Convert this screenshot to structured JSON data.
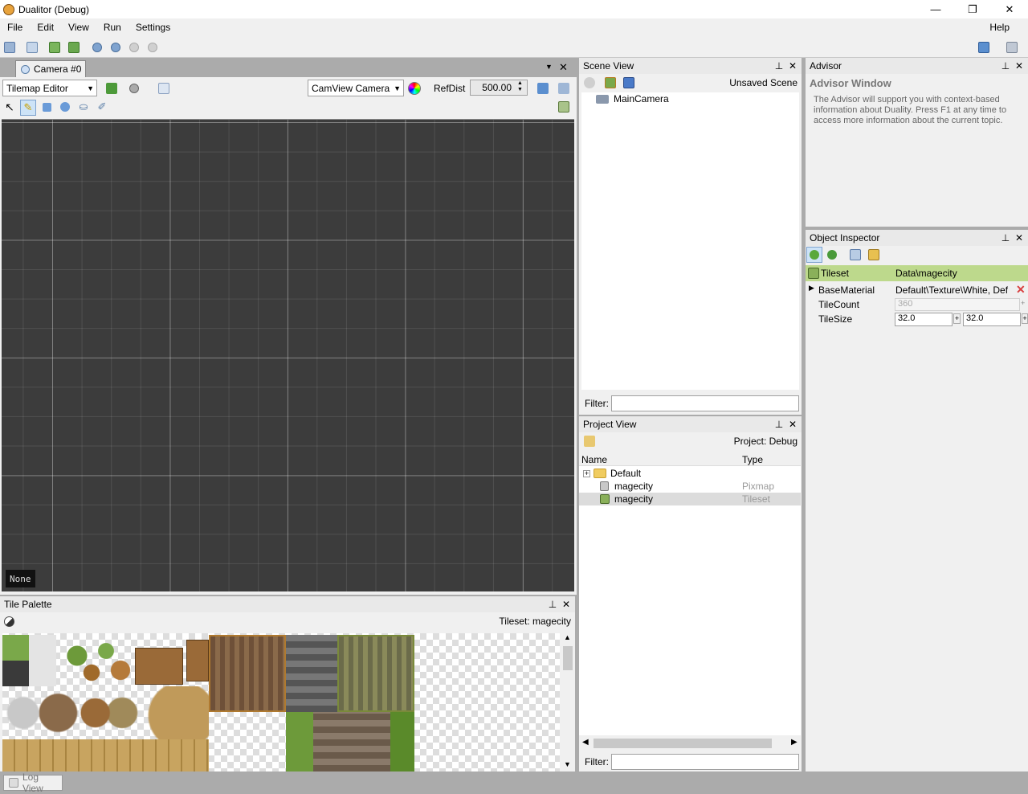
{
  "window": {
    "title": "Dualitor (Debug)",
    "minimize": "—",
    "restore": "❐",
    "close": "✕"
  },
  "menu": {
    "file": "File",
    "edit": "Edit",
    "view": "View",
    "run": "Run",
    "settings": "Settings",
    "help": "Help"
  },
  "camera": {
    "tab_label": "Camera #0",
    "editor_mode": "Tilemap Editor",
    "view_mode": "CamView Camera",
    "refdist_label": "RefDist",
    "refdist_value": "500.00",
    "status_label": "None"
  },
  "tile_palette": {
    "title": "Tile Palette",
    "tileset_label": "Tileset: magecity"
  },
  "scene_view": {
    "title": "Scene View",
    "status": "Unsaved Scene",
    "items": [
      "MainCamera"
    ],
    "filter_label": "Filter:"
  },
  "project_view": {
    "title": "Project View",
    "project": "Project: Debug",
    "columns": {
      "name": "Name",
      "type": "Type"
    },
    "rows": [
      {
        "name": "Default",
        "type": ""
      },
      {
        "name": "magecity",
        "type": "Pixmap"
      },
      {
        "name": "magecity",
        "type": "Tileset"
      }
    ],
    "filter_label": "Filter:"
  },
  "advisor": {
    "title": "Advisor",
    "heading": "Advisor Window",
    "text": "The Advisor will support you with context-based information about Duality. Press F1 at any time to access more information about the current topic."
  },
  "inspector": {
    "title": "Object Inspector",
    "type_label": "Tileset",
    "type_value": "Data\\magecity",
    "props": {
      "base_material_label": "BaseMaterial",
      "base_material_value": "Default\\Texture\\White, Defa",
      "tile_count_label": "TileCount",
      "tile_count_value": "360",
      "tile_size_label": "TileSize",
      "tile_size_x": "32.0",
      "tile_size_y": "32.0"
    }
  },
  "log_view": {
    "label": "Log View"
  },
  "colors": {
    "accent_green": "#bdd98c",
    "grid_bg": "#3c3c3c",
    "selection": "#dcdcdc"
  }
}
